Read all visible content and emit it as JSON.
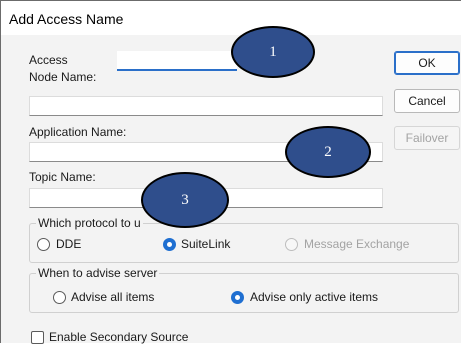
{
  "dialog": {
    "title": "Add Access Name"
  },
  "form": {
    "access_label": "Access",
    "access_value": "",
    "node_label": "Node Name:",
    "node_value": "",
    "application_label": "Application Name:",
    "application_value": "",
    "topic_label": "Topic Name:",
    "topic_value": ""
  },
  "buttons": {
    "ok": "OK",
    "cancel": "Cancel",
    "failover": "Failover"
  },
  "protocol": {
    "legend": "Which protocol to u",
    "options": [
      {
        "label": "DDE",
        "selected": false,
        "enabled": true
      },
      {
        "label": "SuiteLink",
        "selected": true,
        "enabled": true
      },
      {
        "label": "Message Exchange",
        "selected": false,
        "enabled": false
      }
    ]
  },
  "advise": {
    "legend": "When to advise server",
    "options": [
      {
        "label": "Advise all items",
        "selected": false
      },
      {
        "label": "Advise only active items",
        "selected": true
      }
    ]
  },
  "secondary": {
    "label": "Enable Secondary Source",
    "checked": false
  },
  "markers": [
    "1",
    "2",
    "3"
  ],
  "colors": {
    "accent": "#2a6fc9",
    "marker_fill": "#2f4e8c"
  }
}
